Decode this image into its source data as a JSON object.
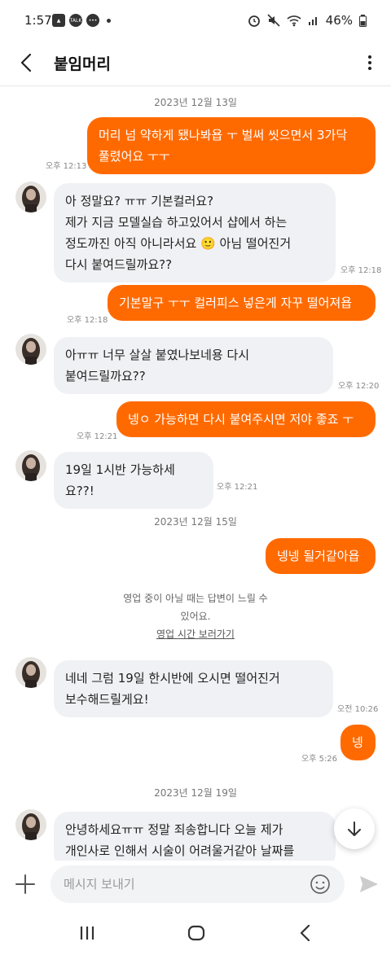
{
  "status_bar": {
    "time": "1:57",
    "battery": "46%",
    "talk_label": "TALK"
  },
  "header": {
    "title": "붙임머리"
  },
  "messages": [
    {
      "date": "2023년 12월 13일"
    },
    {
      "me_1_line1": "머리 넘 약하게 됐나봐욥 ㅜ 벌써 씻으면서 3가닥",
      "me_1_line2": "풀렸어요 ㅜㅜ",
      "me_1_ts": "오후 12:13"
    }
  ],
  "chat": {
    "date_1": "2023년 12월 13일",
    "me_1": {
      "line1": "머리 넘 약하게 됐나봐욥 ㅜ 벌써 씻으면서 3가닥",
      "line2": "풀렸어요 ㅜㅜ",
      "time": "오후 12:13"
    },
    "them_1": {
      "line1": "아 정말요? ㅠㅠ 기본컬러요?",
      "line2": "제가 지금 모델실습 하고있어서 샵에서 하는",
      "line3": "정도까진 아직 아니라서요 🙂 아님 떨어진거",
      "line4": "다시 붙여드릴까요??",
      "time": "오후 12:18"
    },
    "me_2": {
      "line1": "기본말구 ㅜㅜ 컬러피스 넣은게 자꾸 떨어져욥",
      "time": "오후 12:18"
    },
    "them_2": {
      "line1": "아ㅠㅠ 너무 살살 붙였나보네용 다시",
      "line2": "붙여드릴까요??",
      "time": "오후 12:20"
    },
    "me_3": {
      "line1": "넹ㅇ 가능하면 다시 붙여주시면 저야 좋죠 ㅜ",
      "time": "오후 12:21"
    },
    "them_3": {
      "line1": "19일 1시반 가능하세요??!",
      "time": "오후 12:21"
    },
    "date_2": "2023년 12월 15일",
    "me_4": {
      "line1": "넹넹 될거같아욥"
    },
    "notice": {
      "line1": "영업 중이 아닐 때는 답변이 느릴 수",
      "line2": "있어요.",
      "link": "영업 시간 보러가기"
    },
    "them_4": {
      "line1": "네네 그럼 19일 한시반에 오시면 떨어진거",
      "line2": "보수해드릴게요!",
      "time": "오전 10:26"
    },
    "me_5": {
      "line1": "넹",
      "time": "오후 5:26"
    },
    "date_3": "2023년 12월 19일",
    "them_5": {
      "line1": "안녕하세요ㅠㅠ 정말 죄송합니다 오늘 제가",
      "line2": "개인사로 인해서 시술이 어려울거같아 날짜를"
    }
  },
  "input": {
    "placeholder": "메시지 보내기"
  },
  "colors": {
    "accent": "#ff6a00",
    "bubble_other": "#f0f1f4"
  },
  "icons": [
    "back-arrow-icon",
    "more-vert-icon",
    "plus-icon",
    "emoji-icon",
    "send-icon",
    "chevron-down-icon",
    "recent-apps-icon",
    "home-icon",
    "back-icon"
  ]
}
